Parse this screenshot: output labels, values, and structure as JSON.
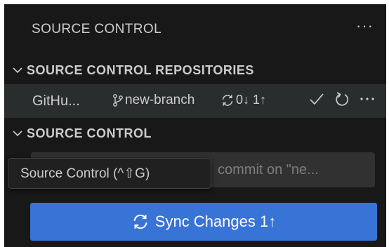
{
  "panel": {
    "title": "SOURCE CONTROL",
    "more_label": "···"
  },
  "repositories_section": {
    "label": "SOURCE CONTROL REPOSITORIES"
  },
  "repository": {
    "name": "GitHu...",
    "branch": "new-branch",
    "sync_counts": "0↓ 1↑"
  },
  "source_control_section": {
    "label": "SOURCE CONTROL"
  },
  "commit_input": {
    "placeholder": "commit on \"ne..."
  },
  "tooltip": {
    "text": "Source Control (^⇧G)"
  },
  "sync_button": {
    "label": "Sync Changes 1↑"
  },
  "colors": {
    "panel_bg": "#181818",
    "row_highlight": "#2a2d2e",
    "button_blue": "#3873d6",
    "text": "#cccccc"
  }
}
